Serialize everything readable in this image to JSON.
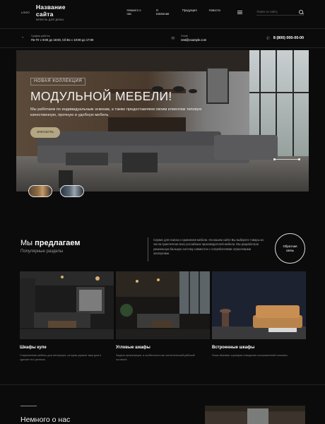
{
  "header": {
    "logo_mark": "LOGO",
    "site_name": "Название сайта",
    "site_subtitle": "МЕБЕЛЬ ДЛЯ ДОМА",
    "nav": [
      "Немного о нас",
      "О компании",
      "Продукция",
      "Новости"
    ],
    "search_placeholder": "Поиск по сайту"
  },
  "info": {
    "hours_label": "График работы",
    "hours_value": "Пн-Пт с 9:00 до 18:00, Сб-Вс с 10:00 до 17:00",
    "email_label": "Email",
    "email_value": "test@example.com",
    "phone": "8 (800) 000-00-00"
  },
  "hero": {
    "tag": "НОВАЯ КОЛЛЕКЦИЯ",
    "title": "МОДУЛЬНОЙ МЕБЕЛИ!",
    "description": "Мы работаем по индивидуальным эскизам, а также предоставляем своим клиентам типовую качественную, прочную и удобную мебель",
    "button": "ЗАКАЗАТЬ"
  },
  "offer": {
    "title_plain": "Мы ",
    "title_bold": "предлагаем",
    "subtitle": "Популярные разделы",
    "description": "Сервис для поиска и сравнения мебели. На нашем сайте Вы выберете товары из числа практически всех российских производителей мебели. Мы разработали уникальную бальную систему совместно с потребителями отраслевыми экспертами.",
    "feedback_line1": "Обратная",
    "feedback_line2": "связь"
  },
  "cards": [
    {
      "title": "Шкафы купе",
      "description": "Современная мебель для интерьера, которая украсит ваш дом и сделает его уютным"
    },
    {
      "title": "Угловые шкафы",
      "description": "Задача организации, в особенности же синтетический рабочий гостиной"
    },
    {
      "title": "Встроенные шкафы",
      "description": "Лишь базовые сценарии поведения пользователей описаны"
    }
  ],
  "about": {
    "title": "Немного о нас"
  },
  "colors": {
    "background": "#0b0b0b",
    "accent": "#b5a683"
  }
}
